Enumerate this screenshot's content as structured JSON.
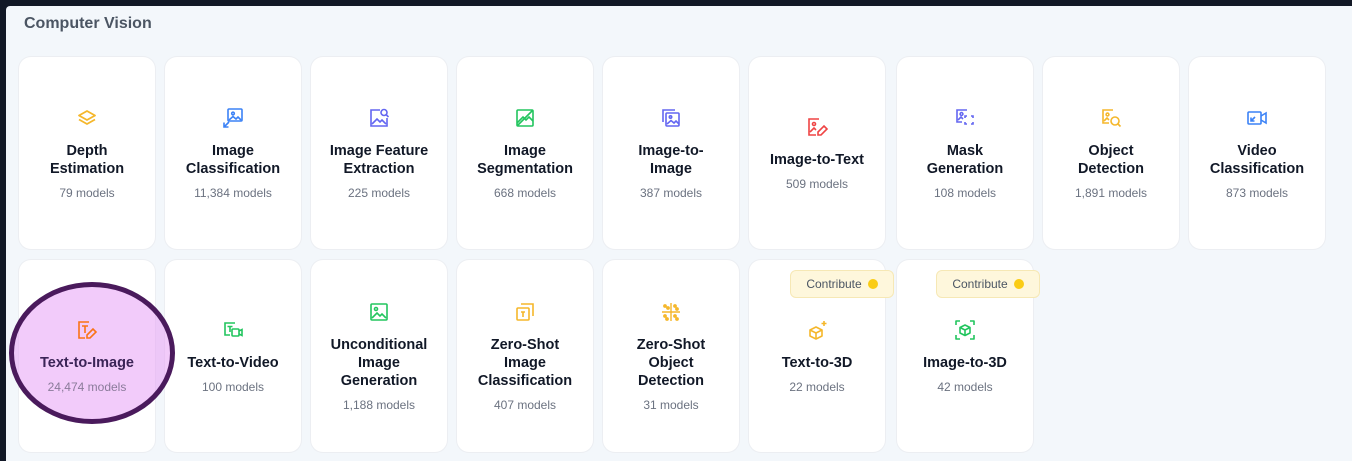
{
  "section": {
    "title": "Computer Vision"
  },
  "contribute": {
    "label": "Contribute"
  },
  "tasks": [
    {
      "label": "Depth\nEstimation",
      "count": "79 models",
      "icon": "layers-icon",
      "color": "#f5b72b"
    },
    {
      "label": "Image\nClassification",
      "count": "11,384 models",
      "icon": "image-classification-icon",
      "color": "#3b82f6"
    },
    {
      "label": "Image Feature\nExtraction",
      "count": "225 models",
      "icon": "image-search-icon",
      "color": "#6366f1"
    },
    {
      "label": "Image\nSegmentation",
      "count": "668 models",
      "icon": "image-segment-icon",
      "color": "#22c55e"
    },
    {
      "label": "Image-to-\nImage",
      "count": "387 models",
      "icon": "image-stack-icon",
      "color": "#6366f1"
    },
    {
      "label": "Image-to-Text",
      "count": "509 models",
      "icon": "image-pen-icon",
      "color": "#ef4444"
    },
    {
      "label": "Mask\nGeneration",
      "count": "108 models",
      "icon": "mask-icon",
      "color": "#6366f1"
    },
    {
      "label": "Object\nDetection",
      "count": "1,891 models",
      "icon": "object-detection-icon",
      "color": "#f5b72b"
    },
    {
      "label": "Video\nClassification",
      "count": "873 models",
      "icon": "video-icon",
      "color": "#3b82f6"
    },
    {
      "label": "Text-to-Image",
      "count": "24,474 models",
      "icon": "text-pen-icon",
      "color": "#f97316"
    },
    {
      "label": "Text-to-Video",
      "count": "100 models",
      "icon": "text-video-icon",
      "color": "#22c55e"
    },
    {
      "label": "Unconditional\nImage\nGeneration",
      "count": "1,188 models",
      "icon": "image-icon",
      "color": "#22c55e"
    },
    {
      "label": "Zero-Shot\nImage\nClassification",
      "count": "407 models",
      "icon": "zero-shot-image-icon",
      "color": "#f5b72b"
    },
    {
      "label": "Zero-Shot\nObject\nDetection",
      "count": "31 models",
      "icon": "scatter-icon",
      "color": "#f5b72b"
    },
    {
      "label": "Text-to-3D",
      "count": "22 models",
      "icon": "cube-plus-icon",
      "color": "#f5b72b"
    },
    {
      "label": "Image-to-3D",
      "count": "42 models",
      "icon": "cube-frame-icon",
      "color": "#22c55e"
    }
  ]
}
